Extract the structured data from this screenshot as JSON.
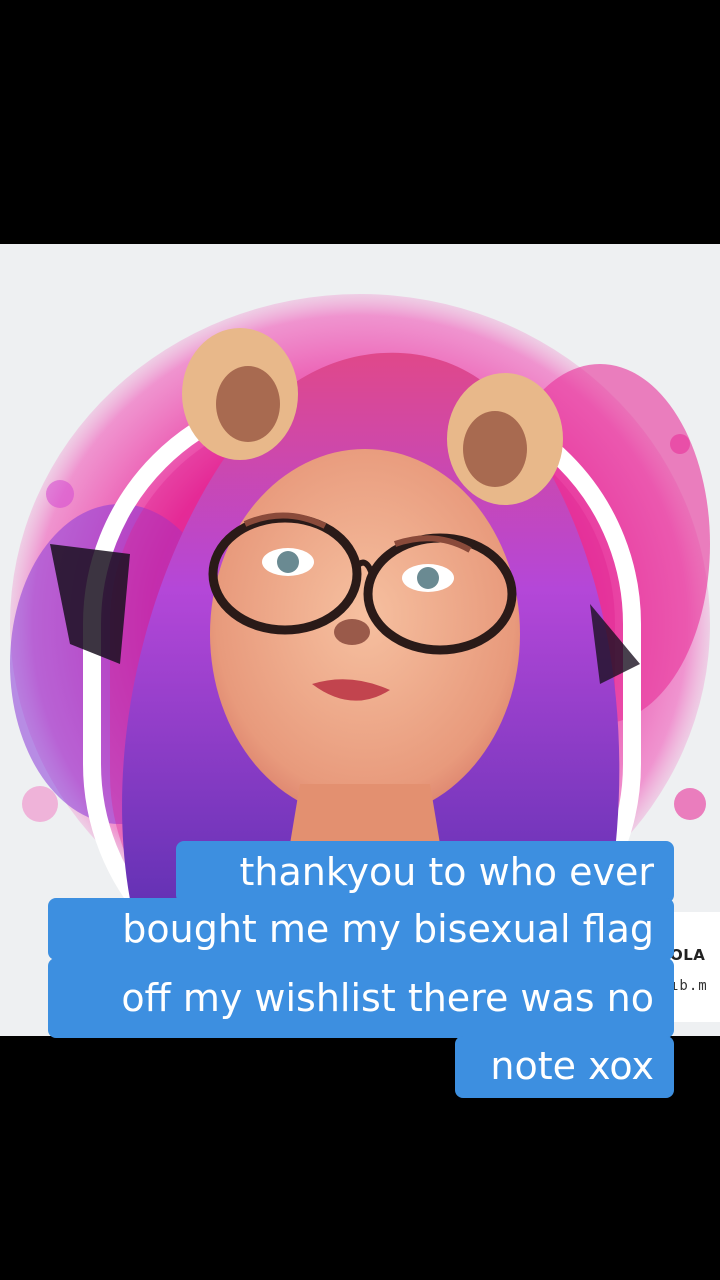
{
  "caption": {
    "lines": [
      "thankyou to who ever",
      "bought me my bisexual flag",
      "off my wishlist there was no",
      "note xox"
    ]
  },
  "side_card": {
    "line1": "OLA",
    "line2": "ıb.m"
  },
  "colors": {
    "caption_bg": "#3d8fe0",
    "splash_pink": "#e8309a",
    "splash_purple": "#8a3ad8",
    "background": "#000000"
  }
}
